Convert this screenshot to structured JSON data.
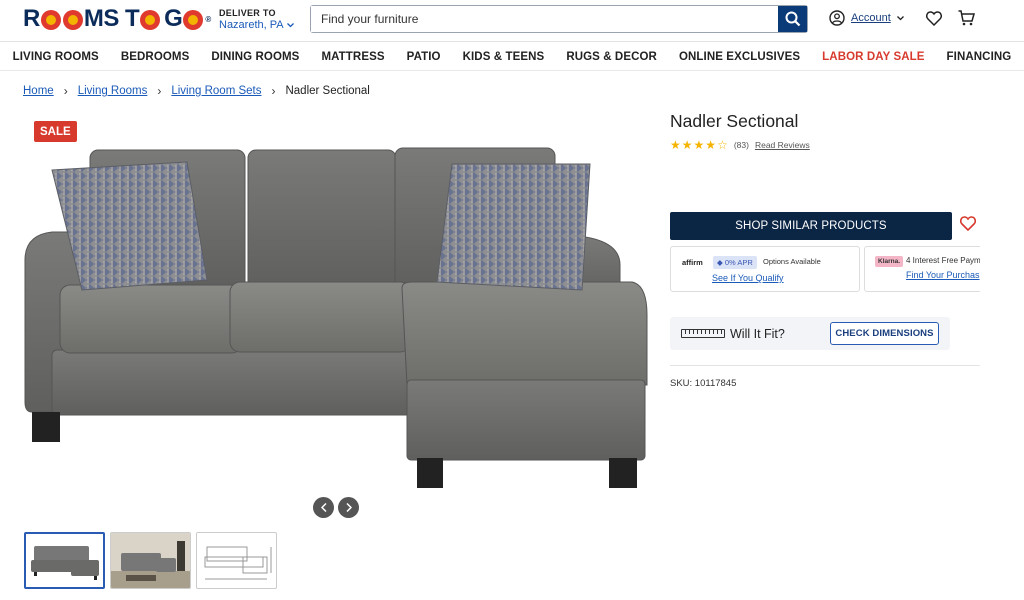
{
  "header": {
    "logo_text": "ROOMS TO GO",
    "deliver_label": "DELIVER TO",
    "deliver_location": "Nazareth, PA",
    "search_placeholder": "Find your furniture",
    "account_label": "Account"
  },
  "nav": {
    "items": [
      {
        "label": "LIVING ROOMS"
      },
      {
        "label": "BEDROOMS"
      },
      {
        "label": "DINING ROOMS"
      },
      {
        "label": "MATTRESS"
      },
      {
        "label": "PATIO"
      },
      {
        "label": "KIDS & TEENS"
      },
      {
        "label": "RUGS & DECOR"
      },
      {
        "label": "ONLINE EXCLUSIVES"
      },
      {
        "label": "LABOR DAY SALE"
      },
      {
        "label": "FINANCING"
      }
    ]
  },
  "breadcrumb": {
    "items": [
      "Home",
      "Living Rooms",
      "Living Room Sets"
    ],
    "current": "Nadler Sectional"
  },
  "product": {
    "sale_badge": "SALE",
    "title": "Nadler Sectional",
    "rating": 4,
    "rating_max": 5,
    "review_count": "(83)",
    "read_reviews": "Read Reviews",
    "shop_similar": "SHOP SIMILAR PRODUCTS",
    "sku": "SKU: 10117845"
  },
  "financing": {
    "affirm_logo": "affirm",
    "apr_badge": "0% APR",
    "options_text": "Options Available",
    "qualify_link": "See If You Qualify",
    "klarna_logo": "Klarna.",
    "klarna_text": "4 Interest Free Paym",
    "klarna_link": "Find Your Purchas"
  },
  "fit": {
    "label": "Will It Fit?",
    "button": "CHECK DIMENSIONS"
  },
  "colors": {
    "brand_navy": "#0b2545",
    "sale_red": "#d73a2d",
    "link_blue": "#1a5ab8"
  }
}
